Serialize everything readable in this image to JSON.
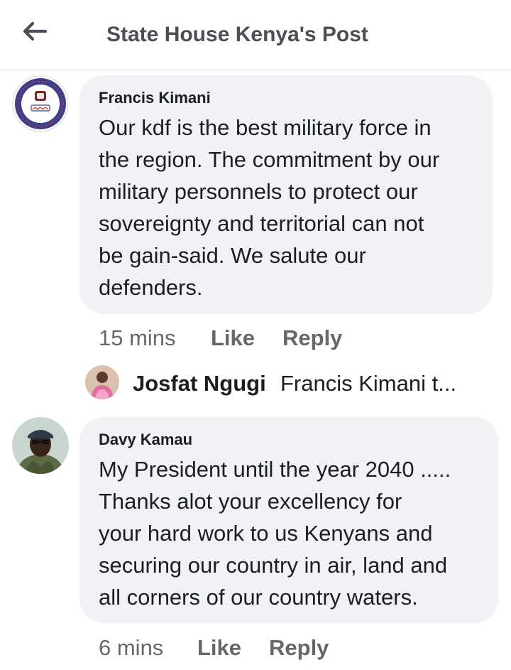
{
  "header": {
    "back_icon": "arrow-left-icon",
    "title": "State House Kenya's Post"
  },
  "comments": [
    {
      "author": "Francis Kimani",
      "avatar_icon": "government-seal-avatar",
      "text": "Our kdf is the best military force in\nthe region. The commitment by our\nmilitary personnels to protect our\nsovereignty and territorial can not\nbe gain-said. We salute our\ndefenders.",
      "time": "15 mins",
      "like_label": "Like",
      "reply_label": "Reply",
      "reply_preview": {
        "author": "Josfat Ngugi",
        "text": "Francis Kimani t..."
      }
    },
    {
      "author": "Davy Kamau",
      "avatar_icon": "user-photo-avatar",
      "text": "My President until the year 2040 .....\nThanks alot your excellency for\nyour hard work to us Kenyans and\nsecuring our country in air, land and\nall corners of our country waters.",
      "time": "6 mins",
      "like_label": "Like",
      "reply_label": "Reply"
    }
  ],
  "colors": {
    "bubble": "#f0f2f5",
    "secondary_text": "#65676b",
    "primary_text": "#1c1e21",
    "header_title": "#4b4f56"
  }
}
